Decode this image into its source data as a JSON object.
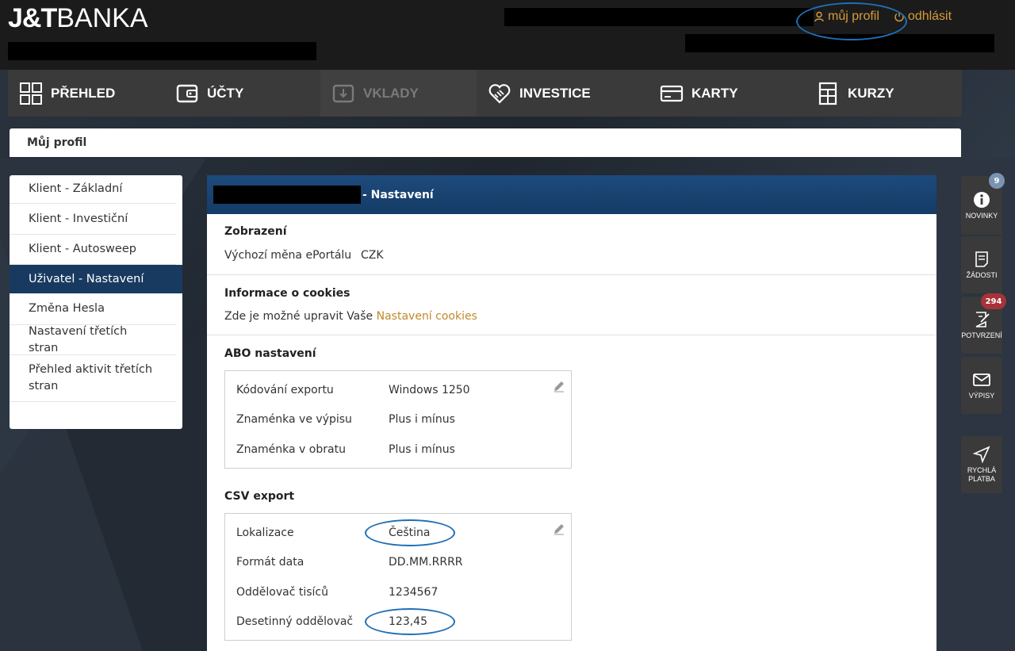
{
  "brand": {
    "logo_bold": "J&T",
    "logo_light": "BANKA"
  },
  "top_links": {
    "profile": "můj profil",
    "logout": "odhlásit"
  },
  "nav": [
    {
      "label": "PŘEHLED",
      "icon": "grid-icon"
    },
    {
      "label": "ÚČTY",
      "icon": "wallet-icon"
    },
    {
      "label": "VKLADY",
      "icon": "deposit-icon"
    },
    {
      "label": "INVESTICE",
      "icon": "handshake-icon"
    },
    {
      "label": "KARTY",
      "icon": "card-icon"
    },
    {
      "label": "KURZY",
      "icon": "table-icon"
    }
  ],
  "breadcrumb": "Můj profil",
  "side_menu": [
    "Klient - Základní",
    "Klient - Investiční",
    "Klient - Autosweep",
    "Uživatel - Nastavení",
    "Změna Hesla",
    "Nastavení třetích stran",
    "Přehled aktivit třetích stran"
  ],
  "main": {
    "header_suffix": "- Nastavení",
    "display": {
      "title": "Zobrazení",
      "label": "Výchozí měna ePortálu",
      "value": "CZK"
    },
    "cookies": {
      "title": "Informace o cookies",
      "text": "Zde je možné upravit Vaše",
      "link": "Nastavení cookies"
    },
    "abo": {
      "title": "ABO nastavení",
      "rows": [
        {
          "label": "Kódování exportu",
          "value": "Windows 1250"
        },
        {
          "label": "Znaménka ve výpisu",
          "value": "Plus i mínus"
        },
        {
          "label": "Znaménka v obratu",
          "value": "Plus i mínus"
        }
      ]
    },
    "csv": {
      "title": "CSV export",
      "rows": [
        {
          "label": "Lokalizace",
          "value": "Čeština"
        },
        {
          "label": "Formát data",
          "value": "DD.MM.RRRR"
        },
        {
          "label": "Oddělovač tisíců",
          "value": "1234567"
        },
        {
          "label": "Desetinný oddělovač",
          "value": "123,45"
        }
      ]
    }
  },
  "tools": [
    {
      "label": "NOVINKY",
      "badge": "9"
    },
    {
      "label": "ŽÁDOSTI"
    },
    {
      "label": "POTVRZENÍ",
      "badge": "294"
    },
    {
      "label": "VÝPISY"
    },
    {
      "label": "RYCHLÁ PLATBA"
    }
  ],
  "colors": {
    "accent": "#d89c3a",
    "navy": "#193a60",
    "annotation": "#1f6fb5",
    "badge_red": "#a8323a",
    "badge_blue": "#7a93b3"
  }
}
